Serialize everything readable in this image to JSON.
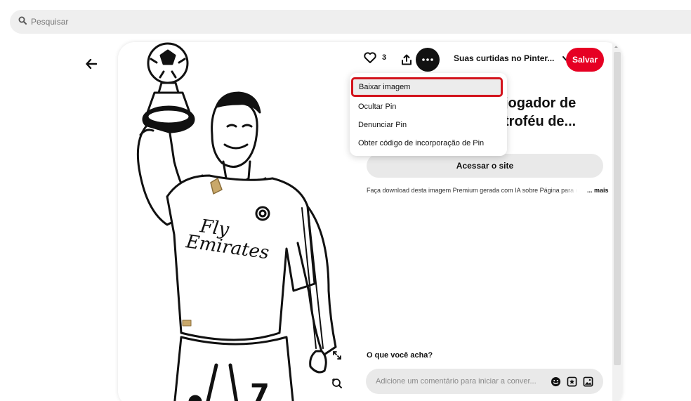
{
  "search": {
    "placeholder": "Pesquisar"
  },
  "pin": {
    "like_count": "3",
    "board_name": "Suas curtidas no Pinter...",
    "save_label": "Salvar",
    "title_line1": "jogador de",
    "title_line2": "troféu de...",
    "visit_label": "Acessar o site",
    "description": "Faça download desta imagem Premium gerada com IA sobre Página para colorir",
    "more_label": "... mais"
  },
  "menu": {
    "items": [
      "Baixar imagem",
      "Ocultar Pin",
      "Denunciar Pin",
      "Obter código de incorporação de Pin"
    ]
  },
  "comments": {
    "heading": "O que você acha?",
    "placeholder": "Adicione um comentário para iniciar a conver..."
  },
  "colors": {
    "accent": "#e60023",
    "highlight_border": "#d3131c"
  },
  "icons": [
    "search-icon",
    "back-arrow-icon",
    "heart-icon",
    "share-icon",
    "more-icon",
    "chevron-down-icon",
    "expand-icon",
    "visual-search-icon",
    "emoji-icon",
    "sticker-icon",
    "image-icon"
  ]
}
